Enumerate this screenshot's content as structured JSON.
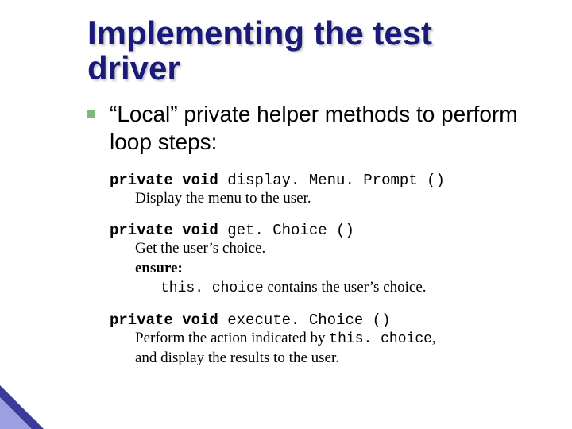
{
  "title": "Implementing the test driver",
  "bullet": "“Local” private helper methods to perform loop steps:",
  "methods": [
    {
      "sig_prefix": "private void",
      "sig_name": "display. Menu. Prompt ()",
      "lines": [
        {
          "text": "Display the menu to the user.",
          "indent": 0
        }
      ]
    },
    {
      "sig_prefix": "private void",
      "sig_name": "get. Choice ()",
      "lines": [
        {
          "text": "Get the user’s choice.",
          "indent": 0
        },
        {
          "bold": "ensure:",
          "indent": 1
        },
        {
          "mono": "this. choice",
          "text": "  contains the user’s choice.",
          "indent": 2
        }
      ]
    },
    {
      "sig_prefix": "private void",
      "sig_name": "execute. Choice ()",
      "lines": [
        {
          "text_pre": "Perform the action indicated by ",
          "mono": "this. choice",
          "text_post": ",",
          "indent": 0
        },
        {
          "text": "and display the results to the user.",
          "indent": 0
        }
      ]
    }
  ]
}
